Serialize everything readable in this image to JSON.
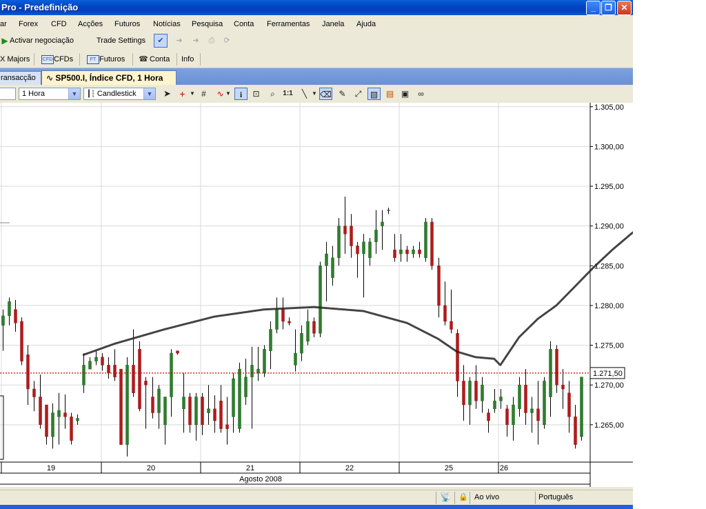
{
  "window": {
    "title": "Pro - Predefinição"
  },
  "menu": [
    "ar",
    "Forex",
    "CFD",
    "Acções",
    "Futuros",
    "Notícias",
    "Pesquisa",
    "Conta",
    "Ferramentas",
    "Janela",
    "Ajuda"
  ],
  "toolbar1": {
    "activate_trading": "Activar negociação",
    "trade_settings": "Trade Settings"
  },
  "toolbar2": {
    "fx_majors": "X Majors",
    "cfds": "CFDs",
    "futures": "Futuros",
    "account": "Conta",
    "info": "Info",
    "cfd_badge": "CFD",
    "ft_badge": "FT"
  },
  "tabs": {
    "transactions": "ransacção",
    "active": "SP500.I, Índice CFD, 1 Hora"
  },
  "chart_toolbar": {
    "interval": "1 Hora",
    "chart_type": "Candlestick",
    "ratio_label": "1:1"
  },
  "icons": [
    "play-icon",
    "checkmark-icon",
    "arrow-left-icon",
    "arrow-right-icon",
    "print-icon",
    "refresh-icon",
    "phone-icon",
    "cursor-arrow-icon",
    "crosshair-icon",
    "grid-icon",
    "indicator-icon",
    "info-icon",
    "zoom-box-icon",
    "zoom-icon",
    "line-tool-icon",
    "eraser-icon",
    "draw-icon",
    "expand-icon",
    "fill-icon",
    "export-icon",
    "link-icon",
    "satellite-icon",
    "lock-icon"
  ],
  "chart_data": {
    "type": "candlestick",
    "symbol": "SP500.I",
    "y_ticks": [
      "1.305,00",
      "1.300,00",
      "1.295,00",
      "1.290,00",
      "1.285,00",
      "1.280,00",
      "1.275,00",
      "1.270,00",
      "1.265,00"
    ],
    "ylim": [
      1260.3,
      1305.5
    ],
    "x_day_labels": [
      "19",
      "20",
      "21",
      "22",
      "25",
      "26"
    ],
    "x_month_label": "Agosto 2008",
    "current_price": 1271.5,
    "current_price_label": "1.271,50",
    "candles": [
      [
        1277.5,
        1279.5,
        1274.3,
        1278.7
      ],
      [
        1278.7,
        1281.0,
        1277.5,
        1280.5
      ],
      [
        1279.5,
        1280.7,
        1276.7,
        1277.8
      ],
      [
        1278.0,
        1278.5,
        1272.5,
        1273.0
      ],
      [
        1273.8,
        1275.0,
        1267.5,
        1269.5
      ],
      [
        1269.5,
        1270.5,
        1266.7,
        1268.5
      ],
      [
        1268.5,
        1271.3,
        1264.5,
        1265.0
      ],
      [
        1267.5,
        1267.5,
        1262.5,
        1263.5
      ],
      [
        1263.5,
        1267.7,
        1262.0,
        1266.5
      ],
      [
        1266.0,
        1269.0,
        1262.5,
        1266.8
      ],
      [
        1266.5,
        1268.8,
        1264.5,
        1266.0
      ],
      [
        1266.0,
        1266.5,
        1262.5,
        1263.0
      ],
      [
        1265.5,
        1266.3,
        1265.0,
        1265.8
      ],
      [
        1270.0,
        1274.0,
        1269.0,
        1272.5
      ],
      [
        1272.0,
        1273.5,
        1272.0,
        1273.0
      ],
      [
        1273.0,
        1274.3,
        1272.5,
        1273.5
      ],
      [
        1273.5,
        1274.0,
        1271.8,
        1272.5
      ],
      [
        1272.5,
        1273.5,
        1270.8,
        1271.5
      ],
      [
        1272.5,
        1274.5,
        1270.5,
        1271.0
      ],
      [
        1272.0,
        1272.0,
        1262.5,
        1262.5
      ],
      [
        1262.5,
        1273.5,
        1261.0,
        1272.5
      ],
      [
        1272.5,
        1277.0,
        1268.5,
        1269.0
      ],
      [
        1274.5,
        1275.5,
        1266.7,
        1267.0
      ],
      [
        1270.5,
        1271.0,
        1264.5,
        1270.0
      ],
      [
        1268.5,
        1271.0,
        1265.8,
        1266.5
      ],
      [
        1266.5,
        1270.0,
        1264.5,
        1269.5
      ],
      [
        1265.0,
        1268.5,
        1262.5,
        1268.5
      ],
      [
        1268.5,
        1274.5,
        1266.0,
        1274.0
      ],
      [
        1274.3,
        1274.3,
        1273.8,
        1274.0
      ],
      [
        1267.0,
        1271.5,
        1264.0,
        1268.5
      ],
      [
        1268.5,
        1269.0,
        1264.0,
        1265.0
      ],
      [
        1265.0,
        1269.0,
        1263.0,
        1268.5
      ],
      [
        1268.5,
        1269.0,
        1263.7,
        1265.0
      ],
      [
        1266.5,
        1270.0,
        1265.0,
        1267.0
      ],
      [
        1267.0,
        1268.7,
        1264.0,
        1265.5
      ],
      [
        1268.0,
        1270.0,
        1264.0,
        1264.5
      ],
      [
        1265.0,
        1268.5,
        1262.5,
        1264.5
      ],
      [
        1266.0,
        1271.5,
        1264.0,
        1270.8
      ],
      [
        1264.5,
        1272.8,
        1264.0,
        1272.0
      ],
      [
        1268.5,
        1273.3,
        1267.5,
        1271.0
      ],
      [
        1271.0,
        1274.8,
        1264.5,
        1272.5
      ],
      [
        1271.5,
        1274.8,
        1270.5,
        1272.0
      ],
      [
        1271.5,
        1275.0,
        1271.0,
        1274.5
      ],
      [
        1274.3,
        1278.0,
        1272.0,
        1277.0
      ],
      [
        1277.0,
        1281.0,
        1276.5,
        1279.5
      ],
      [
        1279.5,
        1281.0,
        1277.0,
        1278.0
      ],
      [
        1278.0,
        1278.5,
        1277.5,
        1277.8
      ],
      [
        1272.5,
        1277.0,
        1271.7,
        1274.0
      ],
      [
        1274.0,
        1277.5,
        1273.0,
        1276.5
      ],
      [
        1275.5,
        1279.5,
        1275.0,
        1278.0
      ],
      [
        1278.0,
        1278.5,
        1276.0,
        1276.5
      ],
      [
        1276.5,
        1285.5,
        1276.0,
        1285.0
      ],
      [
        1285.0,
        1288.0,
        1280.5,
        1286.5
      ],
      [
        1283.5,
        1287.5,
        1282.5,
        1286.0
      ],
      [
        1286.0,
        1291.0,
        1285.0,
        1290.0
      ],
      [
        1290.0,
        1293.7,
        1286.5,
        1289.0
      ],
      [
        1290.0,
        1291.5,
        1286.0,
        1287.5
      ],
      [
        1287.5,
        1288.0,
        1283.5,
        1286.5
      ],
      [
        1286.5,
        1289.0,
        1281.0,
        1288.0
      ],
      [
        1286.0,
        1288.5,
        1285.0,
        1288.0
      ],
      [
        1288.0,
        1292.0,
        1286.5,
        1289.5
      ],
      [
        1290.0,
        1292.0,
        1287.0,
        1290.5
      ],
      [
        1292.0,
        1292.3,
        1291.5,
        1292.0
      ],
      [
        1287.0,
        1289.0,
        1285.5,
        1286.0
      ],
      [
        1286.5,
        1289.0,
        1285.5,
        1287.0
      ],
      [
        1287.0,
        1287.5,
        1285.5,
        1286.5
      ],
      [
        1286.5,
        1287.5,
        1286.0,
        1287.0
      ],
      [
        1287.0,
        1288.0,
        1286.0,
        1286.5
      ],
      [
        1286.0,
        1291.0,
        1285.5,
        1290.5
      ],
      [
        1290.5,
        1291.0,
        1284.5,
        1285.0
      ],
      [
        1285.0,
        1286.0,
        1278.5,
        1280.0
      ],
      [
        1280.0,
        1283.0,
        1277.5,
        1278.0
      ],
      [
        1278.0,
        1282.0,
        1276.5,
        1277.0
      ],
      [
        1276.5,
        1277.0,
        1268.5,
        1270.5
      ],
      [
        1270.5,
        1272.5,
        1265.5,
        1267.5
      ],
      [
        1267.5,
        1271.0,
        1265.0,
        1270.5
      ],
      [
        1270.5,
        1272.5,
        1267.0,
        1268.0
      ],
      [
        1268.0,
        1271.0,
        1266.5,
        1270.0
      ],
      [
        1266.5,
        1267.0,
        1264.0,
        1265.5
      ],
      [
        1267.0,
        1269.5,
        1266.5,
        1268.0
      ],
      [
        1268.0,
        1269.5,
        1267.0,
        1268.5
      ],
      [
        1267.0,
        1267.5,
        1263.5,
        1265.0
      ],
      [
        1265.0,
        1268.5,
        1263.0,
        1267.5
      ],
      [
        1267.0,
        1271.0,
        1266.0,
        1270.0
      ],
      [
        1270.0,
        1272.0,
        1265.0,
        1266.5
      ],
      [
        1266.5,
        1268.5,
        1264.0,
        1267.0
      ],
      [
        1267.0,
        1270.5,
        1262.5,
        1265.5
      ],
      [
        1265.0,
        1271.0,
        1264.5,
        1270.5
      ],
      [
        1268.5,
        1275.5,
        1266.0,
        1274.5
      ],
      [
        1274.5,
        1275.0,
        1269.0,
        1270.0
      ],
      [
        1270.0,
        1272.0,
        1267.0,
        1269.5
      ],
      [
        1269.0,
        1270.5,
        1264.0,
        1266.0
      ],
      [
        1266.0,
        1267.5,
        1262.0,
        1262.5
      ],
      [
        1263.5,
        1271.0,
        1263.0,
        1271.0
      ]
    ],
    "drawn_curve": [
      [
        13,
        1273.8
      ],
      [
        18,
        1275.2
      ],
      [
        26,
        1277.0
      ],
      [
        34,
        1278.6
      ],
      [
        42,
        1279.5
      ],
      [
        50,
        1279.8
      ],
      [
        58,
        1279.3
      ],
      [
        65,
        1277.8
      ],
      [
        70,
        1275.8
      ],
      [
        73,
        1274.2
      ],
      [
        76,
        1273.5
      ],
      [
        79,
        1273.3
      ],
      [
        80,
        1272.5
      ],
      [
        83,
        1276.0
      ],
      [
        86,
        1278.3
      ],
      [
        89,
        1280.0
      ],
      [
        92,
        1282.4
      ],
      [
        95,
        1284.8
      ],
      [
        98,
        1287.0
      ],
      [
        101,
        1289.0
      ],
      [
        104,
        1290.8
      ],
      [
        107,
        1292.0
      ],
      [
        111,
        1292.5
      ],
      [
        115,
        1292.8
      ],
      [
        119,
        1292.6
      ],
      [
        122,
        1291.6
      ],
      [
        124,
        1290.5
      ],
      [
        126,
        1288.6
      ],
      [
        128,
        1286.6
      ],
      [
        130,
        1283.5
      ],
      [
        131,
        1281.0
      ],
      [
        133,
        1278.0
      ],
      [
        134,
        1275.8
      ],
      [
        135,
        1273.0
      ],
      [
        136,
        1271.3
      ],
      [
        137,
        1272.5
      ],
      [
        140,
        1274.3
      ],
      [
        144,
        1275.7
      ],
      [
        148,
        1276.2
      ],
      [
        152,
        1276.4
      ],
      [
        155,
        1276.3
      ],
      [
        157,
        1275.8
      ],
      [
        158,
        1275.0
      ]
    ]
  }
}
